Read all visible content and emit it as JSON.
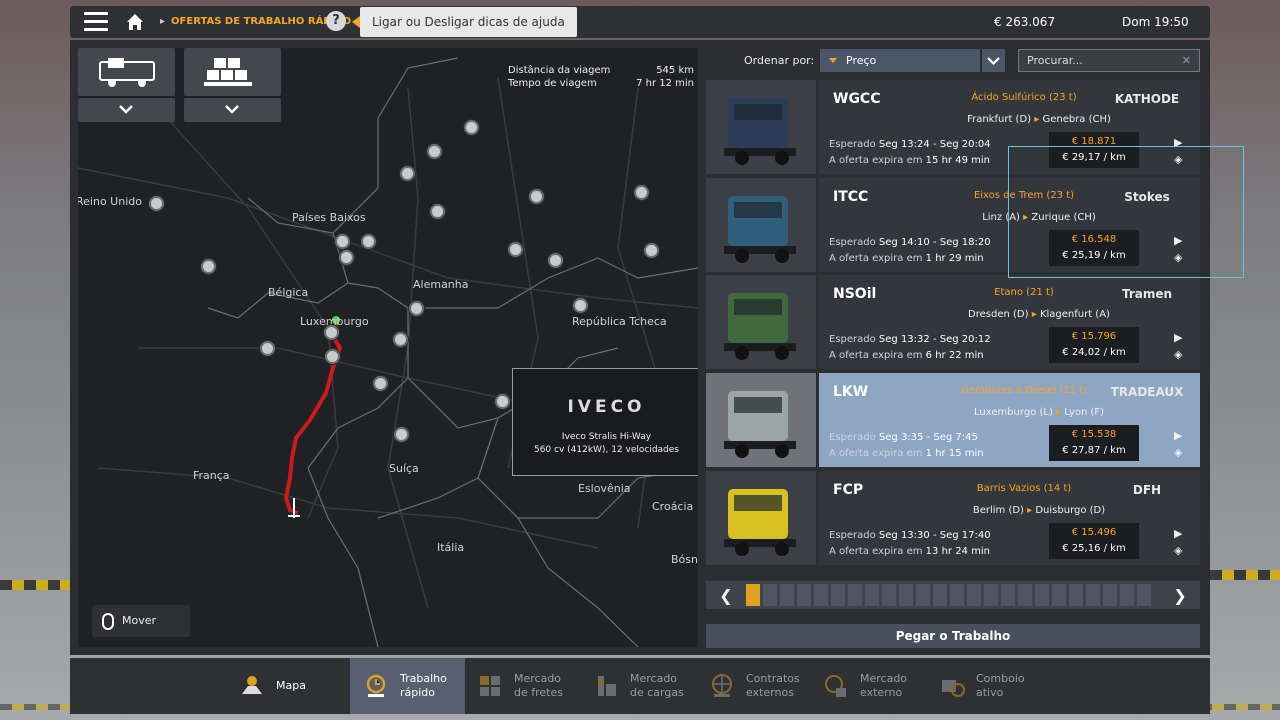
{
  "topbar": {
    "breadcrumb": "OFERTAS DE TRABALHO RÁPIDO",
    "help_tooltip": "Ligar ou Desligar dicas de ajuda",
    "money": "€ 263.067",
    "datetime": "Dom 19:50"
  },
  "map": {
    "info": {
      "distance_label": "Distância da viagem",
      "distance_value": "545 km",
      "time_label": "Tempo de viagem",
      "time_value": "7 hr 12 min"
    },
    "labels": [
      "Reino Unido",
      "Países Baixos",
      "Alemanha",
      "Bélgica",
      "Luxemburgo",
      "República Tcheca",
      "França",
      "Suíça",
      "Eslovênia",
      "Croácia",
      "Itália",
      "Bósni"
    ],
    "move_map": "Mover mapa",
    "truck": {
      "brand": "IVECO",
      "model": "Iveco Stralis Hi-Way",
      "spec": "560 cv (412kW), 12 velocidades"
    }
  },
  "sort": {
    "label": "Ordenar por:",
    "selected": "Preço",
    "search_placeholder": "Procurar..."
  },
  "jobs": [
    {
      "company": "WGCC",
      "cargo": "Ácido Sulfúrico (23 t)",
      "from": "Frankfurt (D)",
      "to": "Genebra (CH)",
      "client": "KATHODE",
      "expected_label": "Esperado",
      "expected": "Seg 13:24 - Seg 20:04",
      "expires_label": "A oferta expira em",
      "expires": "15 hr 49 min",
      "price": "€ 18.871",
      "per_km": "€ 29,17 / km",
      "truck_color": "#2a3c5a"
    },
    {
      "company": "ITCC",
      "cargo": "Eixos de Trem (23 t)",
      "from": "Linz (A)",
      "to": "Zurique (CH)",
      "client": "Stokes",
      "expected_label": "Esperado",
      "expected": "Seg 14:10 - Seg 18:20",
      "expires_label": "A oferta expira em",
      "expires": "1 hr 29 min",
      "price": "€ 16.548",
      "per_km": "€ 25,19 / km",
      "truck_color": "#2f5f7a"
    },
    {
      "company": "NSOil",
      "cargo": "Etano (21 t)",
      "from": "Dresden (D)",
      "to": "Klagenfurt (A)",
      "client": "Tramen",
      "expected_label": "Esperado",
      "expected": "Seg 13:32 - Seg 20:12",
      "expires_label": "A oferta expira em",
      "expires": "6 hr 22 min",
      "price": "€ 15.796",
      "per_km": "€ 24,02 / km",
      "truck_color": "#3e6a3e"
    },
    {
      "company": "LKW",
      "cargo": "Geradores à Diesel (21 t)",
      "from": "Luxemburgo (L)",
      "to": "Lyon (F)",
      "client": "TRADEAUX",
      "expected_label": "Esperado",
      "expected": "Seg 3:35 - Seg 7:45",
      "expires_label": "A oferta expira em",
      "expires": "1 hr 15 min",
      "price": "€ 15.538",
      "per_km": "€ 27,87 / km",
      "truck_color": "#9aa6a4"
    },
    {
      "company": "FCP",
      "cargo": "Barris Vazios (14 t)",
      "from": "Berlim (D)",
      "to": "Duisburgo (D)",
      "client": "DFH",
      "expected_label": "Esperado",
      "expected": "Seg 13:30 - Seg 17:40",
      "expires_label": "A oferta expira em",
      "expires": "13 hr 24 min",
      "price": "€ 15.496",
      "per_km": "€ 25,16 / km",
      "truck_color": "#d8c020"
    }
  ],
  "take_job": "Pegar o Trabalho",
  "nav": [
    {
      "label": "Mapa",
      "icon": "map-icon"
    },
    {
      "label": "Trabalho rápido",
      "icon": "quick-job-icon"
    },
    {
      "label": "Mercado de fretes",
      "icon": "freight-market-icon"
    },
    {
      "label": "Mercado de cargas",
      "icon": "cargo-market-icon"
    },
    {
      "label": "Contratos externos",
      "icon": "external-contracts-icon"
    },
    {
      "label": "Mercado externo",
      "icon": "external-market-icon"
    },
    {
      "label": "Comboio ativo",
      "icon": "convoy-icon"
    }
  ]
}
